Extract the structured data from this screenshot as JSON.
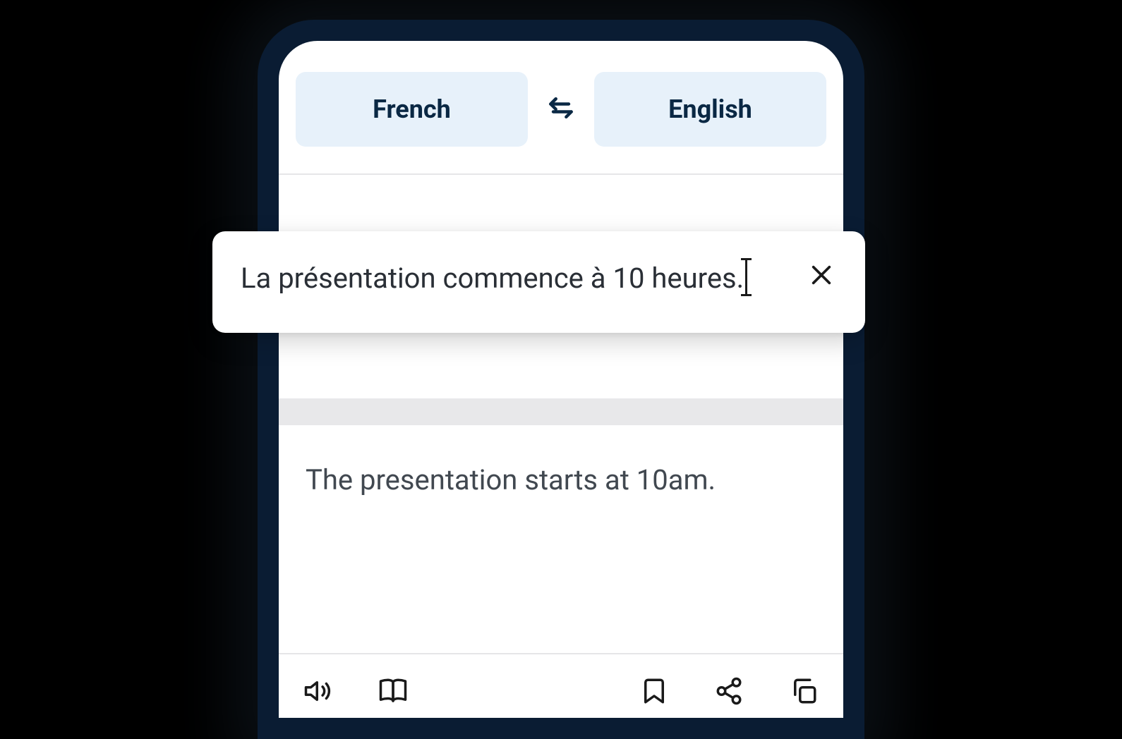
{
  "languageSelector": {
    "source": "French",
    "target": "English"
  },
  "input": {
    "text": "La présentation commence à 10 heures."
  },
  "output": {
    "text": "The presentation starts at 10am."
  },
  "colors": {
    "phoneFrame": "#0a1c33",
    "pillBg": "#e7f1fa",
    "pillText": "#0a2844",
    "bodyText": "#2a2f36",
    "outputText": "#414850"
  }
}
